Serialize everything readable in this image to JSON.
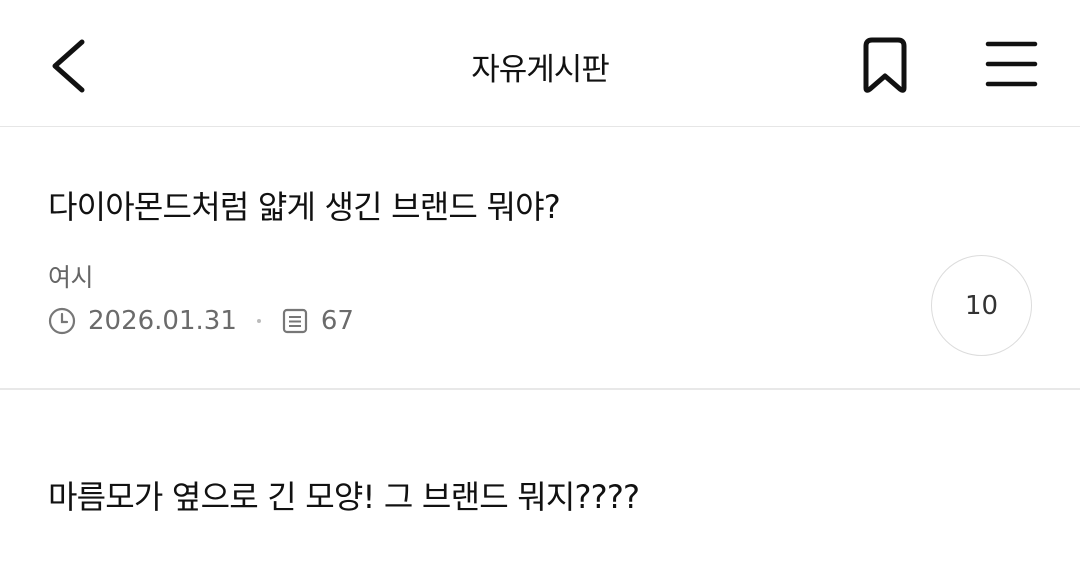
{
  "header": {
    "title": "자유게시판"
  },
  "posts": [
    {
      "title": "다이아몬드처럼 얇게 생긴 브랜드 뭐야?",
      "author": "여시",
      "date": "2026.01.31",
      "views": "67",
      "comments": "10"
    },
    {
      "title": "마름모가 옆으로 긴 모양! 그 브랜드 뭐지????"
    }
  ],
  "icons": {
    "back": "chevron-left-icon",
    "bookmark": "bookmark-icon",
    "menu": "hamburger-menu-icon",
    "clock": "clock-icon",
    "views": "document-icon"
  }
}
